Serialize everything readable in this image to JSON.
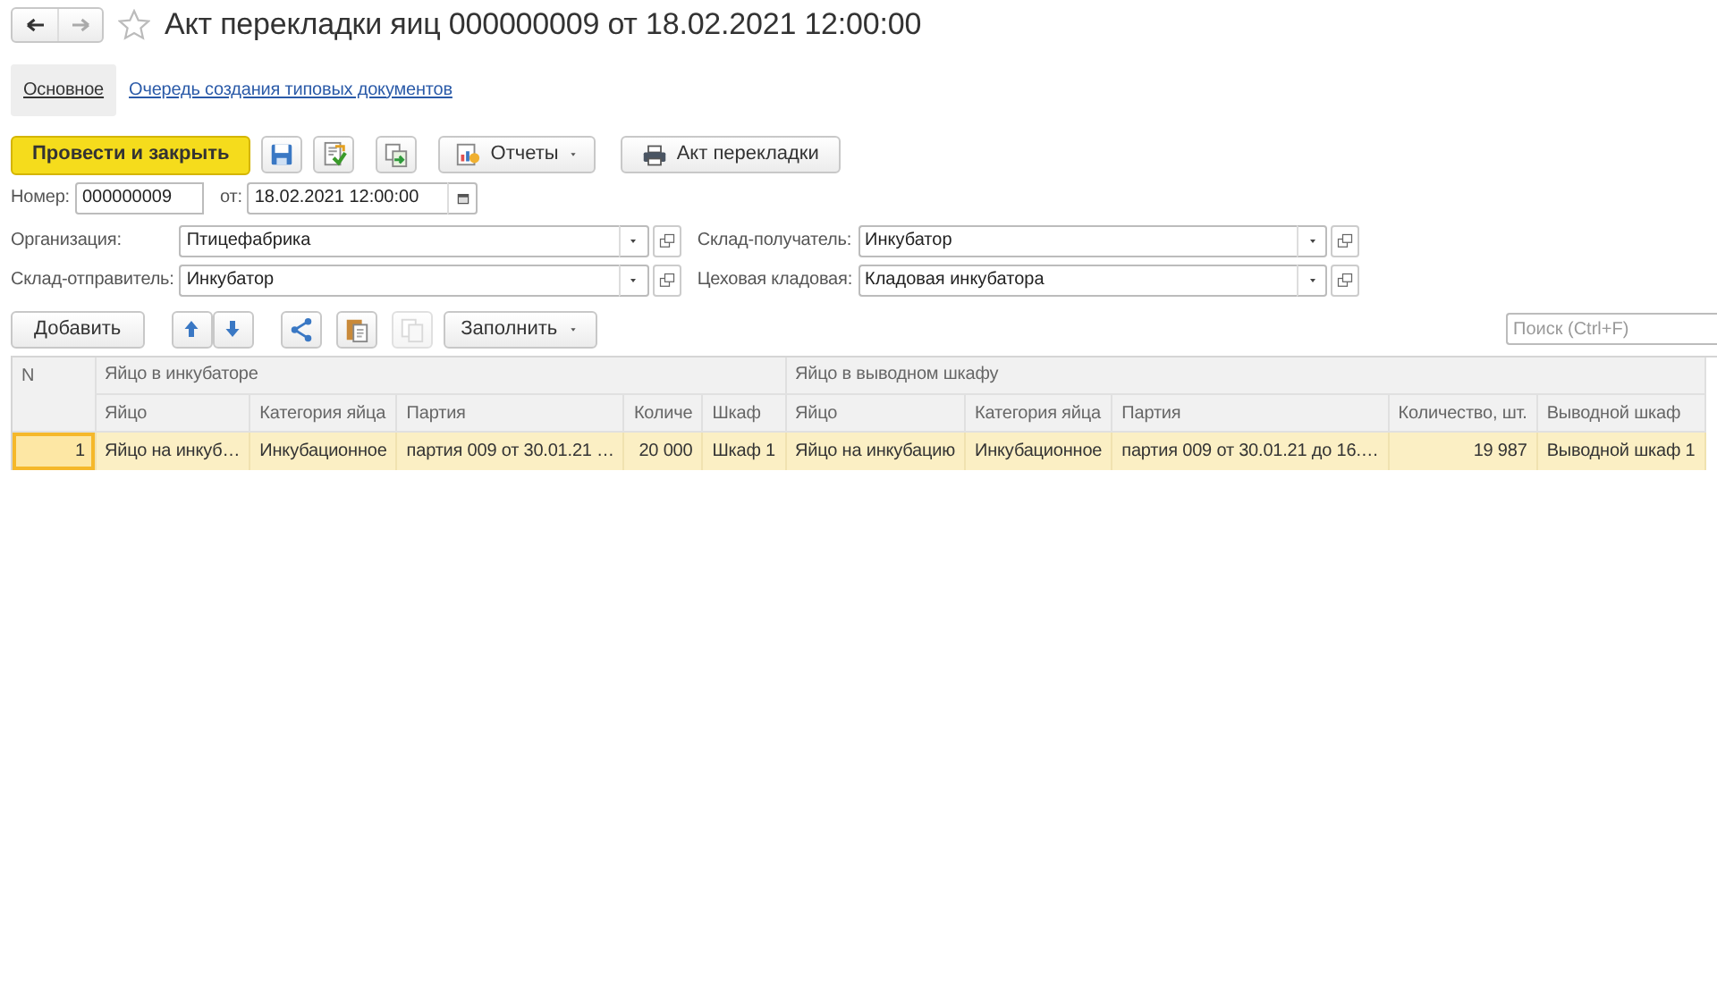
{
  "nav": {
    "back_disabled": false,
    "forward_disabled": true
  },
  "favorite": false,
  "title": "Акт перекладки яиц 000000009 от 18.02.2021 12:00:00",
  "tabs": [
    {
      "label": "Основное",
      "selected": true
    },
    {
      "label": "Очередь создания типовых документов",
      "selected": false
    }
  ],
  "toolbar": [
    {
      "kind": "primary",
      "label": "Провести и закрыть"
    },
    {
      "kind": "icon"
    },
    {
      "kind": "icon"
    },
    {
      "kind": "icon"
    },
    {
      "kind": "menu",
      "label": "Отчеты"
    },
    {
      "kind": "print",
      "label": "Акт перекладки"
    }
  ],
  "number": {
    "label": "Номер:",
    "value": "000000009"
  },
  "date": {
    "label": "от:",
    "value": "18.02.2021 12:00:00"
  },
  "fields": [
    {
      "label": "Организация:",
      "value": "Птицефабрика"
    },
    {
      "label": "Склад-получатель:",
      "value": "Инкубатор"
    },
    {
      "label": "Склад-отправитель:",
      "value": "Инкубатор"
    },
    {
      "label": "Цеховая кладовая:",
      "value": "Кладовая инкубатора"
    }
  ],
  "table_toolbar": [
    {
      "kind": "text",
      "label": "Добавить"
    },
    {
      "kind": "updown"
    },
    {
      "kind": "icon",
      "disabled": false
    },
    {
      "kind": "icon",
      "disabled": false
    },
    {
      "kind": "icon",
      "disabled": true
    },
    {
      "kind": "menu",
      "label": "Заполнить"
    }
  ],
  "search": {
    "placeholder": "Поиск (Ctrl+F)"
  },
  "table": {
    "number_column": "N",
    "groups": [
      {
        "title": "Яйцо в инкубаторе",
        "columns": [
          "Яйцо",
          "Категория яйца",
          "Партия",
          "Количе",
          "Шкаф"
        ]
      },
      {
        "title": "Яйцо в выводном шкафу",
        "columns": [
          "Яйцо",
          "Категория яйца",
          "Партия",
          "Количество, шт.",
          "Выводной шкаф"
        ]
      }
    ],
    "rows": [
      {
        "selected": true,
        "cells": [
          "1",
          "Яйцо на инкуб…",
          "Инкубационное",
          "партия 009 от 30.01.21 …",
          "20 000",
          "Шкаф 1",
          "Яйцо на инкубацию",
          "Инкубационное",
          "партия 009 от 30.01.21 до 16.…",
          "19 987",
          "Выводной шкаф 1"
        ]
      }
    ]
  }
}
